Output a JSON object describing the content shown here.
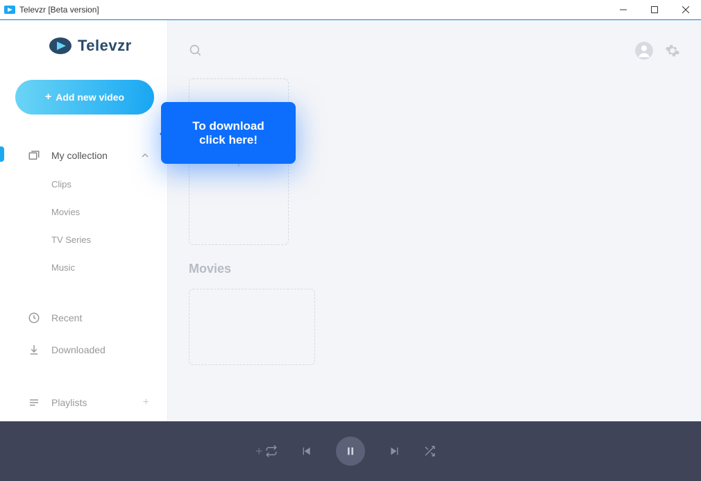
{
  "window": {
    "title": "Televzr [Beta version]"
  },
  "brand": {
    "name": "Televzr"
  },
  "actions": {
    "add_video": "Add new video"
  },
  "tooltip": {
    "line1": "To download",
    "line2": "click here!"
  },
  "sidebar": {
    "collection": {
      "label": "My collection",
      "items": [
        {
          "label": "Clips"
        },
        {
          "label": "Movies"
        },
        {
          "label": "TV Series"
        },
        {
          "label": "Music"
        }
      ]
    },
    "recent": "Recent",
    "downloaded": "Downloaded",
    "playlists": "Playlists"
  },
  "main": {
    "sections": [
      {
        "title": ""
      },
      {
        "title": "Movies"
      }
    ]
  }
}
